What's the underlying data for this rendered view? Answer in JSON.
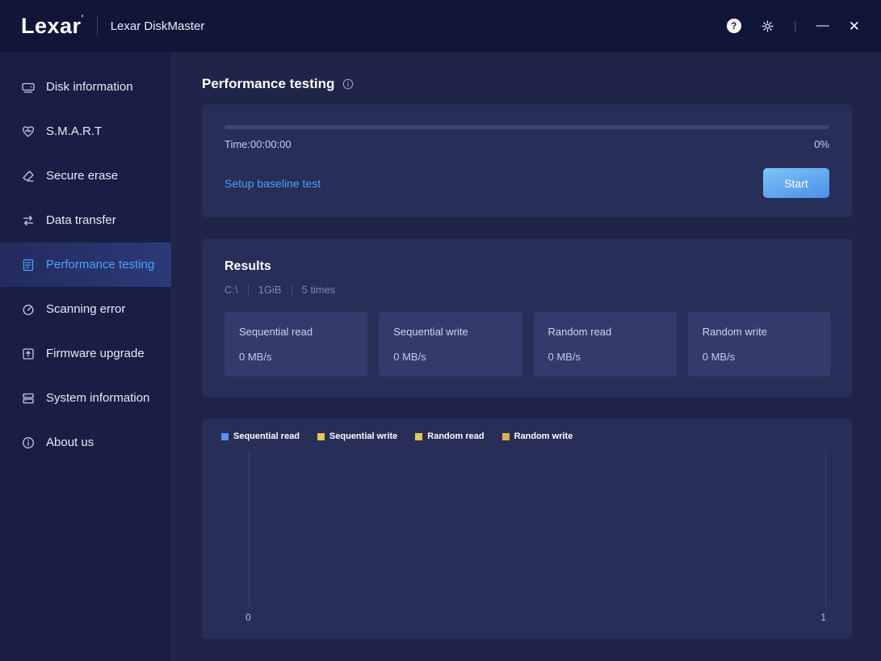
{
  "titlebar": {
    "logo": "Lexar",
    "app_name": "Lexar DiskMaster",
    "help_glyph": "?",
    "divider_glyph": "|",
    "minimize_glyph": "—",
    "close_glyph": "✕"
  },
  "sidebar": {
    "items": [
      {
        "label": "Disk information",
        "icon": "disk-icon",
        "active": false
      },
      {
        "label": "S.M.A.R.T",
        "icon": "smart-heart-icon",
        "active": false
      },
      {
        "label": "Secure erase",
        "icon": "secure-erase-icon",
        "active": false
      },
      {
        "label": "Data transfer",
        "icon": "data-transfer-icon",
        "active": false
      },
      {
        "label": "Performance testing",
        "icon": "performance-testing-icon",
        "active": true
      },
      {
        "label": "Scanning error",
        "icon": "scanning-error-icon",
        "active": false
      },
      {
        "label": "Firmware upgrade",
        "icon": "firmware-upgrade-icon",
        "active": false
      },
      {
        "label": "System information",
        "icon": "system-information-icon",
        "active": false
      },
      {
        "label": "About us",
        "icon": "about-us-icon",
        "active": false
      }
    ]
  },
  "main": {
    "page_title": "Performance testing",
    "test_panel": {
      "time_label": "Time:00:00:00",
      "progress_percent": "0%",
      "progress_value": 0,
      "setup_link": "Setup baseline test",
      "start_button": "Start"
    },
    "results": {
      "heading": "Results",
      "drive": "C:\\",
      "size": "1GiB",
      "iterations": "5 times",
      "tiles": [
        {
          "label": "Sequential read",
          "value": "0 MB/s"
        },
        {
          "label": "Sequential write",
          "value": "0 MB/s"
        },
        {
          "label": "Random read",
          "value": "0 MB/s"
        },
        {
          "label": "Random write",
          "value": "0 MB/s"
        }
      ]
    }
  },
  "chart_data": {
    "type": "line",
    "series": [
      {
        "name": "Sequential read",
        "color": "#5b8ff9",
        "values": []
      },
      {
        "name": "Sequential write",
        "color": "#e8c64d",
        "values": []
      },
      {
        "name": "Random read",
        "color": "#e8c64d",
        "values": []
      },
      {
        "name": "Random write",
        "color": "#dfb13f",
        "values": []
      }
    ],
    "x_ticks": [
      "0",
      "1"
    ],
    "xlim": [
      0,
      1
    ],
    "legend_position": "top-left",
    "grid": false
  }
}
